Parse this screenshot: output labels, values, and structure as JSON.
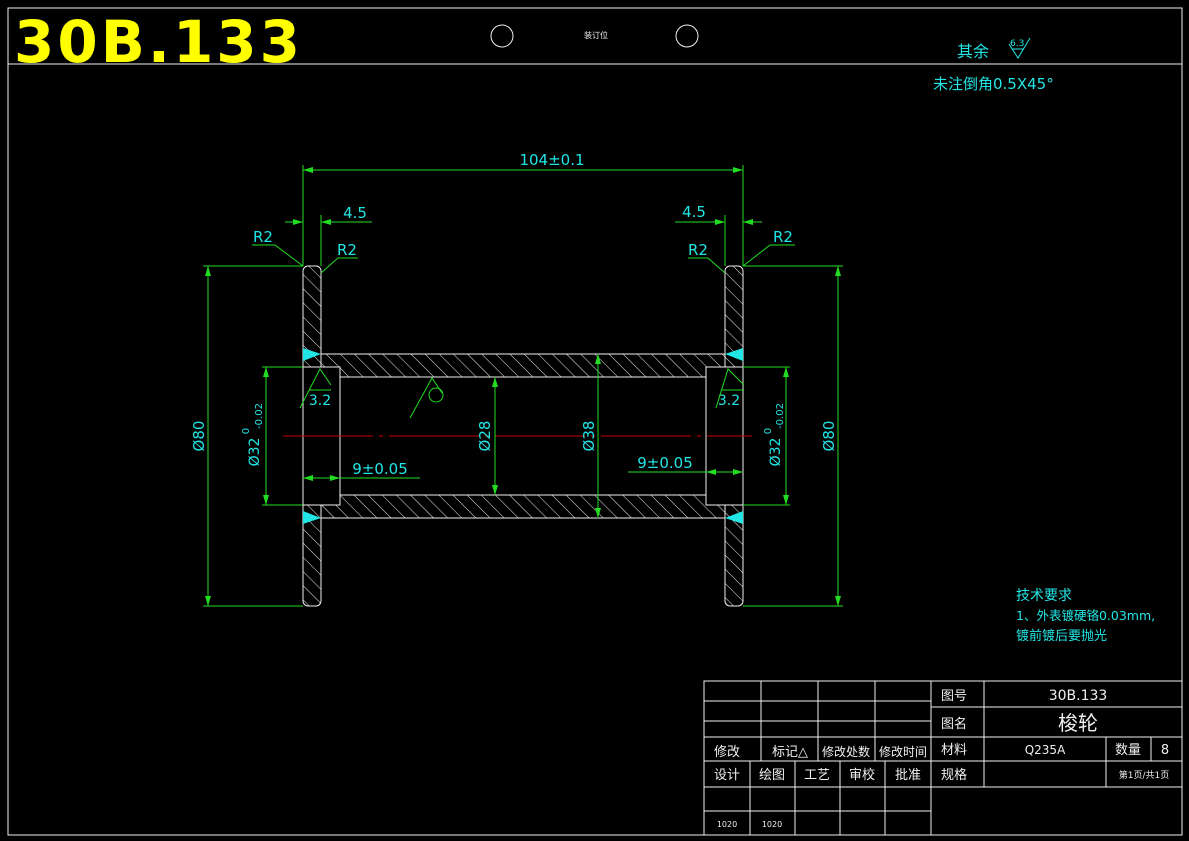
{
  "header": {
    "drawing_number": "30B.133",
    "binding_label": "装订位"
  },
  "notes": {
    "roughness_prefix": "其余",
    "roughness_value": "6.3",
    "chamfer_note": "未注倒角0.5X45°",
    "tech_title": "技术要求",
    "tech_line1": "1、外表镀硬铬0.03mm,",
    "tech_line2": "镀前镀后要抛光"
  },
  "dimensions": {
    "overall_length": "104±0.1",
    "flange_left": "4.5",
    "flange_right": "4.5",
    "radius_outer_left": "R2",
    "radius_inner_left": "R2",
    "radius_inner_right": "R2",
    "radius_outer_right": "R2",
    "dia_outer_left": "Ø80",
    "dia_outer_right": "Ø80",
    "dia_bore_left": "Ø32",
    "dia_bore_right": "Ø32",
    "tol_upper": "0",
    "tol_lower": "-0.02",
    "dia_inner": "Ø28",
    "dia_tube": "Ø38",
    "bore_depth_left": "9±0.05",
    "bore_depth_right": "9±0.05",
    "roughness_left": "3.2",
    "roughness_right": "3.2"
  },
  "title_block": {
    "label_drawing_no": "图号",
    "drawing_no": "30B.133",
    "label_name": "图名",
    "part_name": "梭轮",
    "label_material": "材料",
    "material": "Q235A",
    "label_qty": "数量",
    "qty": "8",
    "label_spec": "规格",
    "page": "第1页/共1页",
    "rev_headers": [
      "修改",
      "标记△",
      "修改处数",
      "修改时间"
    ],
    "sign_headers": [
      "设计",
      "绘图",
      "工艺",
      "审校",
      "批准"
    ],
    "sign_dates": [
      "1020",
      "1020"
    ]
  },
  "colors": {
    "outline": "#ffffff",
    "dimension": "#22dd22",
    "annotation": "#22e6e6",
    "centerline": "#cc0000",
    "title": "#ffff00"
  }
}
